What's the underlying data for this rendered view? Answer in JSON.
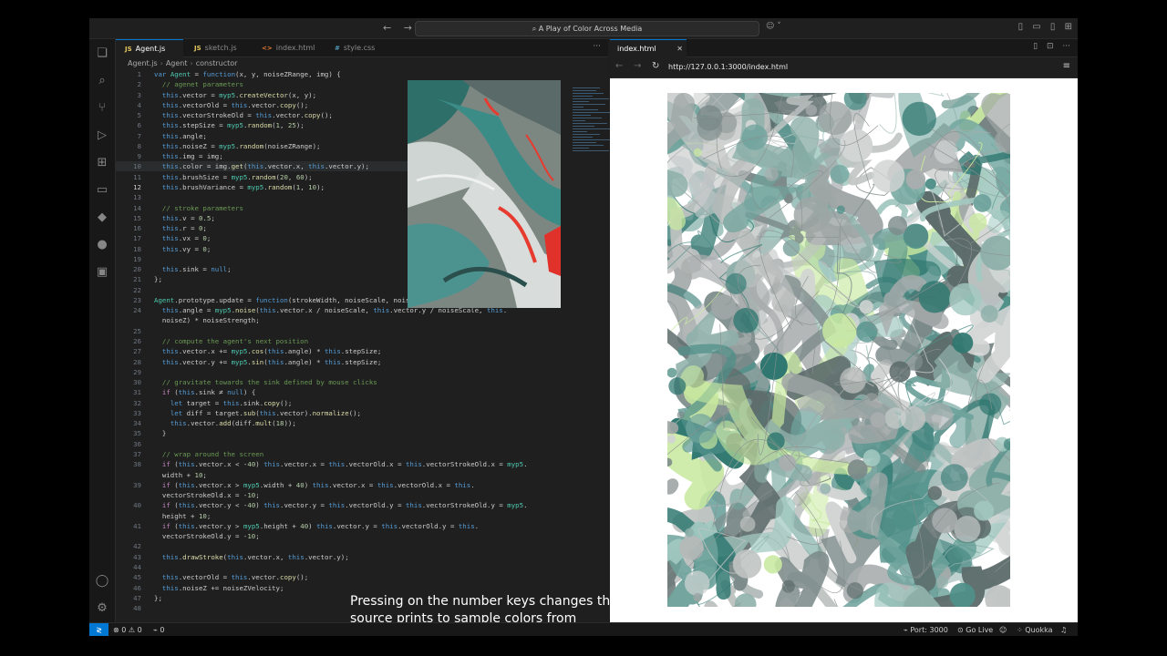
{
  "titlebar": {
    "title": "A Play of Color Across Media",
    "back": "←",
    "forward": "→"
  },
  "editor": {
    "tabs": [
      {
        "label": "Agent.js",
        "icon": "JS",
        "active": true
      },
      {
        "label": "sketch.js",
        "icon": "JS",
        "active": false
      },
      {
        "label": "index.html",
        "icon": "<>",
        "active": false
      },
      {
        "label": "style.css",
        "icon": "#",
        "active": false
      }
    ],
    "breadcrumb": [
      "Agent.js",
      "Agent",
      "constructor"
    ],
    "current_line": 12,
    "code": [
      {
        "n": "1",
        "t": "var Agent = function(x, y, noiseZRange, img) {"
      },
      {
        "n": "2",
        "t": "  // agenet parameters"
      },
      {
        "n": "3",
        "t": "  this.vector = myp5.createVector(x, y);"
      },
      {
        "n": "4",
        "t": "  this.vectorOld = this.vector.copy();"
      },
      {
        "n": "5",
        "t": "  this.vectorStrokeOld = this.vector.copy();"
      },
      {
        "n": "6",
        "t": "  this.stepSize = myp5.random(1, 25);"
      },
      {
        "n": "7",
        "t": "  this.angle;"
      },
      {
        "n": "8",
        "t": "  this.noiseZ = myp5.random(noiseZRange);"
      },
      {
        "n": "9",
        "t": "  this.img = img;"
      },
      {
        "n": "10",
        "t": "  this.color = img.get(this.vector.x, this.vector.y);"
      },
      {
        "n": "11",
        "t": "  this.brushSize = myp5.random(20, 60);"
      },
      {
        "n": "12",
        "t": "  this.brushVariance = myp5.random(1, 10);"
      },
      {
        "n": "13",
        "t": ""
      },
      {
        "n": "14",
        "t": "  // stroke parameters"
      },
      {
        "n": "15",
        "t": "  this.v = 0.5;"
      },
      {
        "n": "16",
        "t": "  this.r = 0;"
      },
      {
        "n": "17",
        "t": "  this.vx = 0;"
      },
      {
        "n": "18",
        "t": "  this.vy = 0;"
      },
      {
        "n": "19",
        "t": ""
      },
      {
        "n": "20",
        "t": "  this.sink = null;"
      },
      {
        "n": "21",
        "t": "};"
      },
      {
        "n": "22",
        "t": ""
      },
      {
        "n": "23",
        "t": "Agent.prototype.update = function(strokeWidth, noiseScale, noiseStrength, noiseZVelocity) {"
      },
      {
        "n": "24",
        "t": "  this.angle = myp5.noise(this.vector.x / noiseScale, this.vector.y / noiseScale, this."
      },
      {
        "n": "",
        "t": "  noiseZ) * noiseStrength;"
      },
      {
        "n": "25",
        "t": ""
      },
      {
        "n": "26",
        "t": "  // compute the agent's next position"
      },
      {
        "n": "27",
        "t": "  this.vector.x += myp5.cos(this.angle) * this.stepSize;"
      },
      {
        "n": "28",
        "t": "  this.vector.y += myp5.sin(this.angle) * this.stepSize;"
      },
      {
        "n": "29",
        "t": ""
      },
      {
        "n": "30",
        "t": "  // gravitate towards the sink defined by mouse clicks"
      },
      {
        "n": "31",
        "t": "  if (this.sink ≠ null) {"
      },
      {
        "n": "32",
        "t": "    let target = this.sink.copy();"
      },
      {
        "n": "33",
        "t": "    let diff = target.sub(this.vector).normalize();"
      },
      {
        "n": "34",
        "t": "    this.vector.add(diff.mult(18));"
      },
      {
        "n": "35",
        "t": "  }"
      },
      {
        "n": "36",
        "t": ""
      },
      {
        "n": "37",
        "t": "  // wrap around the screen"
      },
      {
        "n": "38",
        "t": "  if (this.vector.x < -40) this.vector.x = this.vectorOld.x = this.vectorStrokeOld.x = myp5."
      },
      {
        "n": "",
        "t": "  width + 10;"
      },
      {
        "n": "39",
        "t": "  if (this.vector.x > myp5.width + 40) this.vector.x = this.vectorOld.x = this."
      },
      {
        "n": "",
        "t": "  vectorStrokeOld.x = -10;"
      },
      {
        "n": "40",
        "t": "  if (this.vector.y < -40) this.vector.y = this.vectorOld.y = this.vectorStrokeOld.y = myp5."
      },
      {
        "n": "",
        "t": "  height + 10;"
      },
      {
        "n": "41",
        "t": "  if (this.vector.y > myp5.height + 40) this.vector.y = this.vectorOld.y = this."
      },
      {
        "n": "",
        "t": "  vectorStrokeOld.y = -10;"
      },
      {
        "n": "42",
        "t": ""
      },
      {
        "n": "43",
        "t": "  this.drawStroke(this.vector.x, this.vector.y);"
      },
      {
        "n": "44",
        "t": ""
      },
      {
        "n": "45",
        "t": "  this.vectorOld = this.vector.copy();"
      },
      {
        "n": "46",
        "t": "  this.noiseZ += noiseZVelocity;"
      },
      {
        "n": "47",
        "t": "};"
      },
      {
        "n": "48",
        "t": ""
      }
    ]
  },
  "caption": "Pressing on the number keys changes the source prints to sample colors from",
  "browser": {
    "tab_label": "index.html",
    "close": "✕",
    "url": "http://127.0.0.1:3000/index.html"
  },
  "statusbar": {
    "errors": "0",
    "warnings": "0",
    "ports_count": "0",
    "port": "Port: 3000",
    "golive": "Go Live",
    "quokka": "Quokka"
  },
  "colors": {
    "accent": "#0078d4",
    "bg": "#1e1e1e"
  }
}
